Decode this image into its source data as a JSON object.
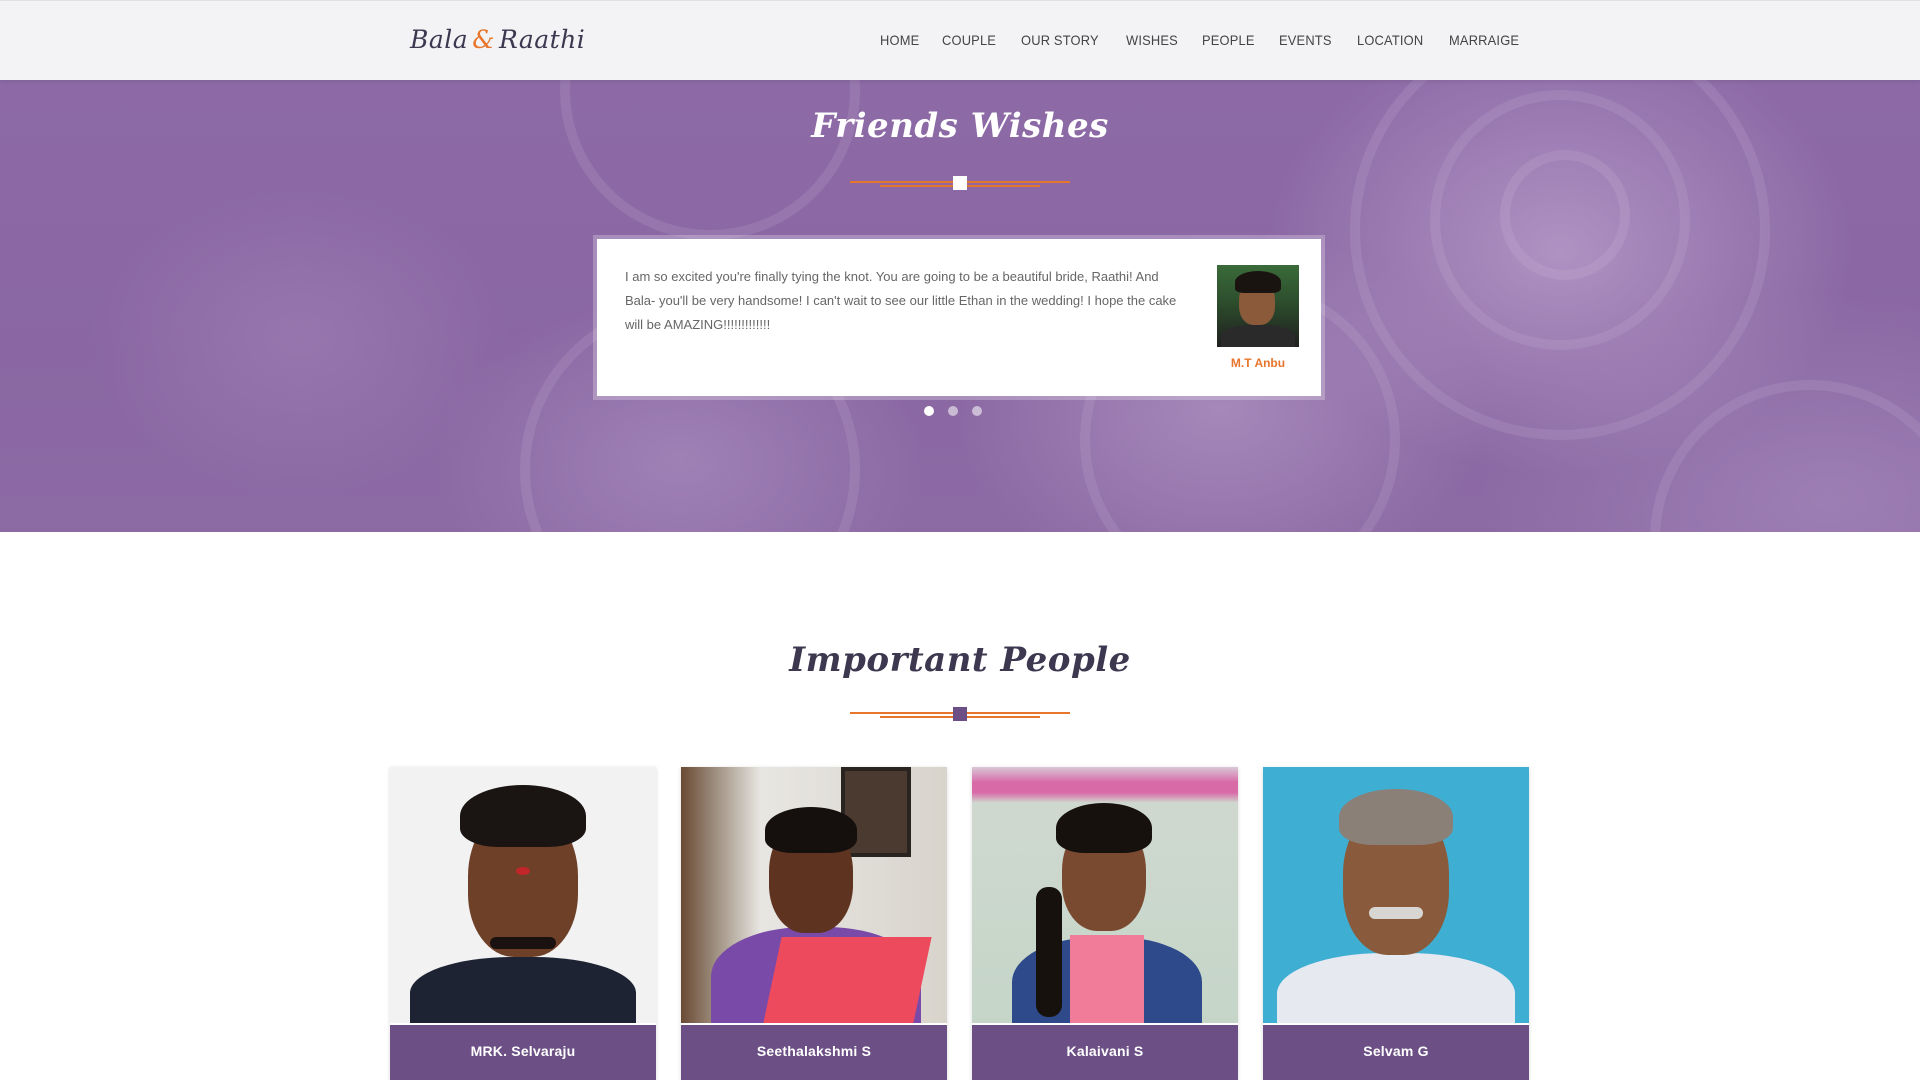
{
  "brand": {
    "first": "Bala",
    "amp": "&",
    "second": "Raathi"
  },
  "nav": {
    "items": [
      {
        "label": "HOME"
      },
      {
        "label": "COUPLE"
      },
      {
        "label": "OUR STORY"
      },
      {
        "label": "WISHES"
      },
      {
        "label": "PEOPLE"
      },
      {
        "label": "EVENTS"
      },
      {
        "label": "LOCATION"
      },
      {
        "label": "MARRAIGE"
      }
    ]
  },
  "wishes": {
    "title": "Friends Wishes",
    "testimonial": {
      "text": "I am so excited you're finally tying the knot. You are going to be a beautiful bride, Raathi! And Bala- you'll be very handsome! I can't wait to see our little Ethan in the wedding! I hope the cake will be AMAZING!!!!!!!!!!!!!",
      "name": "M.T Anbu"
    },
    "carousel_dots": 3,
    "active_dot": 1
  },
  "people": {
    "title": "Important People",
    "members": [
      {
        "name": "MRK. Selvaraju"
      },
      {
        "name": "Seethalakshmi S"
      },
      {
        "name": "Kalaivani S"
      },
      {
        "name": "Selvam G"
      }
    ]
  },
  "colors": {
    "accent": "#e7752b",
    "brand_text": "#3d3850",
    "purple_band": "#8b68a3",
    "caption_bg": "#6b4f85",
    "divider_square_light": "#ffffff",
    "divider_square_dark": "#6b4f85"
  }
}
